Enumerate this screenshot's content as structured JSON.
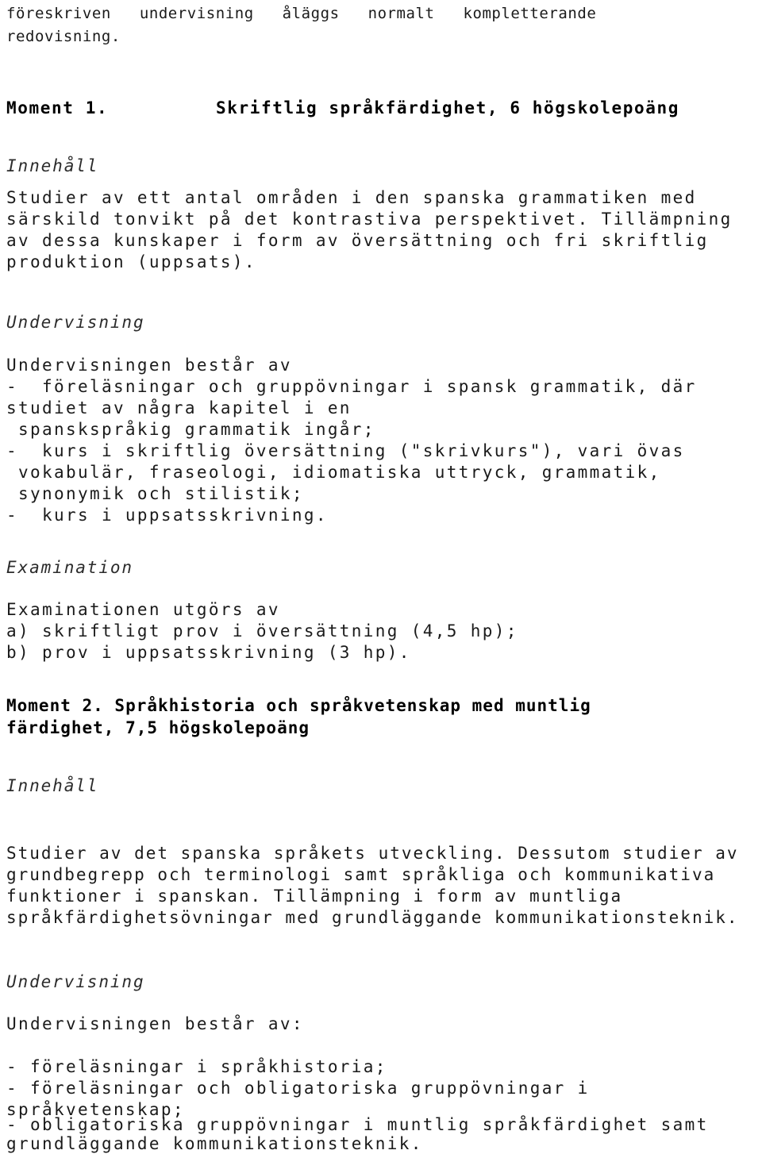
{
  "document": {
    "language": "sv",
    "intro": {
      "line1": "föreskriven   undervisning   åläggs   normalt   kompletterande",
      "line2": "redovisning."
    },
    "moments": [
      {
        "label": "Moment 1.",
        "title": "Skriftlig språkfärdighet, 6 högskolepoäng",
        "sections": [
          {
            "heading": "Innehåll",
            "lines": [
              "Studier av ett antal områden i den spanska grammatiken med",
              "särskild tonvikt på det kontrastiva perspektivet. Tillämpning",
              "av dessa kunskaper i form av översättning och fri skriftlig",
              "produktion (uppsats)."
            ]
          },
          {
            "heading": "Undervisning",
            "lines": [
              "Undervisningen består av",
              "-  föreläsningar och gruppövningar i spansk grammatik, där",
              "studiet av några kapitel i en",
              " spanskspråkig grammatik ingår;",
              "-  kurs i skriftlig översättning (\"skrivkurs\"), vari övas",
              " vokabulär, fraseologi, idiomatiska uttryck, grammatik,",
              " synonymik och stilistik;",
              "-  kurs i uppsatsskrivning."
            ]
          },
          {
            "heading": "Examination",
            "lines": [
              "Examinationen utgörs av",
              "a) skriftligt prov i översättning (4,5 hp);",
              "b) prov i uppsatsskrivning (3 hp)."
            ]
          }
        ]
      },
      {
        "label": "Moment 2.",
        "title_line1": "Moment 2. Språkhistoria och språkvetenskap med muntlig",
        "title_line2": "färdighet, 7,5 högskolepoäng",
        "sections": [
          {
            "heading": "Innehåll",
            "lines": [
              "Studier av det spanska språkets utveckling. Dessutom studier av",
              "grundbegrepp och terminologi samt språkliga och kommunikativa",
              "funktioner i spanskan. Tillämpning i form av muntliga",
              "språkfärdighetsövningar med grundläggande kommunikationsteknik."
            ]
          },
          {
            "heading": "Undervisning",
            "lines": [
              "Undervisningen består av:",
              "- föreläsningar i språkhistoria;",
              "- föreläsningar och obligatoriska gruppövningar i",
              "språkvetenskap;",
              "- obligatoriska gruppövningar i muntlig språkfärdighet samt",
              "grundläggande kommunikationsteknik."
            ]
          }
        ]
      }
    ]
  }
}
